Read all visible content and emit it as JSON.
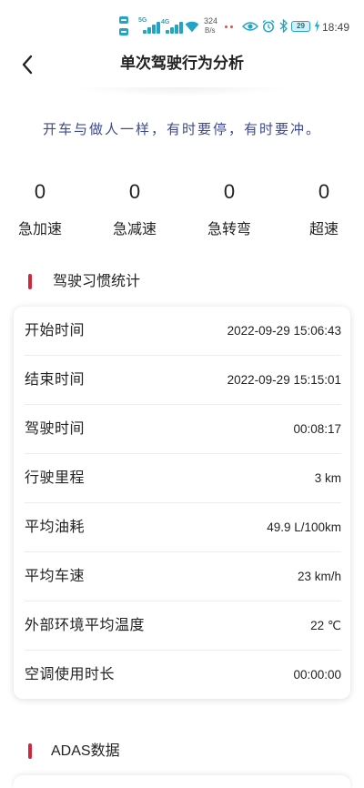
{
  "status_bar": {
    "sim1_network": "5G",
    "sim2_network": "4G",
    "net_speed_value": "324",
    "net_speed_unit": "B/s",
    "battery": "29",
    "time": "18:49",
    "icons": [
      "volte-hd-icon",
      "signal-icon",
      "wifi-icon",
      "notification-dots-icon",
      "eye-icon",
      "alarm-icon",
      "bluetooth-icon",
      "battery-icon",
      "charging-icon"
    ]
  },
  "header": {
    "back_icon": "chevron-left-icon",
    "title": "单次驾驶行为分析"
  },
  "quote": "开车与做人一样，有时要停，有时要冲。",
  "stats": [
    {
      "value": "0",
      "label": "急加速"
    },
    {
      "value": "0",
      "label": "急减速"
    },
    {
      "value": "0",
      "label": "急转弯"
    },
    {
      "value": "0",
      "label": "超速"
    }
  ],
  "habits": {
    "title": "驾驶习惯统计",
    "rows": [
      {
        "label": "开始时间",
        "value": "2022-09-29 15:06:43"
      },
      {
        "label": "结束时间",
        "value": "2022-09-29 15:15:01"
      },
      {
        "label": "驾驶时间",
        "value": "00:08:17"
      },
      {
        "label": "行驶里程",
        "value": "3 km"
      },
      {
        "label": "平均油耗",
        "value": "49.9 L/100km"
      },
      {
        "label": "平均车速",
        "value": "23 km/h"
      },
      {
        "label": "外部环境平均温度",
        "value": "22 ℃"
      },
      {
        "label": "空调使用时长",
        "value": "00:00:00"
      }
    ]
  },
  "adas": {
    "title": "ADAS数据"
  },
  "colors": {
    "status_icon": "#23a4c4",
    "quote": "#3e4a8c",
    "section_accent": "#d0283a",
    "text": "#222222",
    "divider": "#ececec",
    "background": "#ffffff"
  }
}
